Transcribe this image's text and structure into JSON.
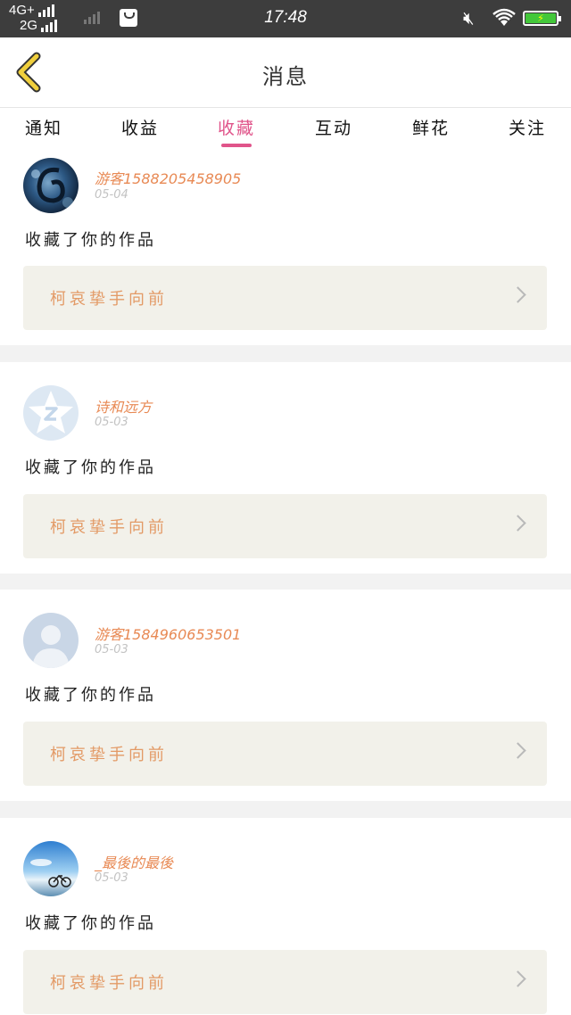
{
  "status_bar": {
    "network_1": "4G+",
    "network_2": "2G",
    "time": "17:48",
    "battery_icon": "battery-charging-icon",
    "wifi_icon": "wifi-icon",
    "mute_icon": "muted-icon"
  },
  "header": {
    "title": "消息",
    "back_icon": "chevron-left-icon",
    "accent": "#f0cf3c"
  },
  "tabs": [
    {
      "label": "通知",
      "active": false
    },
    {
      "label": "收益",
      "active": false
    },
    {
      "label": "收藏",
      "active": true
    },
    {
      "label": "互动",
      "active": false
    },
    {
      "label": "鲜花",
      "active": false
    },
    {
      "label": "关注",
      "active": false
    }
  ],
  "colors": {
    "active_tab": "#e0548a",
    "username": "#e88a55",
    "work_title": "#e39a66",
    "work_bg": "#f2f1ea"
  },
  "messages": [
    {
      "username": "游客15882054589​05",
      "date": "05-04",
      "action": "收藏了你的作品",
      "work_title": "柯哀挚手向前",
      "avatar": "blue-swirl-avatar"
    },
    {
      "username": "诗和远方",
      "date": "05-03",
      "action": "收藏了你的作品",
      "work_title": "柯哀挚手向前",
      "avatar": "qzone-star-avatar"
    },
    {
      "username": "游客15849606535​01",
      "date": "05-03",
      "action": "收藏了你的作品",
      "work_title": "柯哀挚手向前",
      "avatar": "default-person-avatar"
    },
    {
      "username": "_最後的最後",
      "date": "05-03",
      "action": "收藏了你的作品",
      "work_title": "柯哀挚手向前",
      "avatar": "sky-bicycle-avatar"
    }
  ]
}
